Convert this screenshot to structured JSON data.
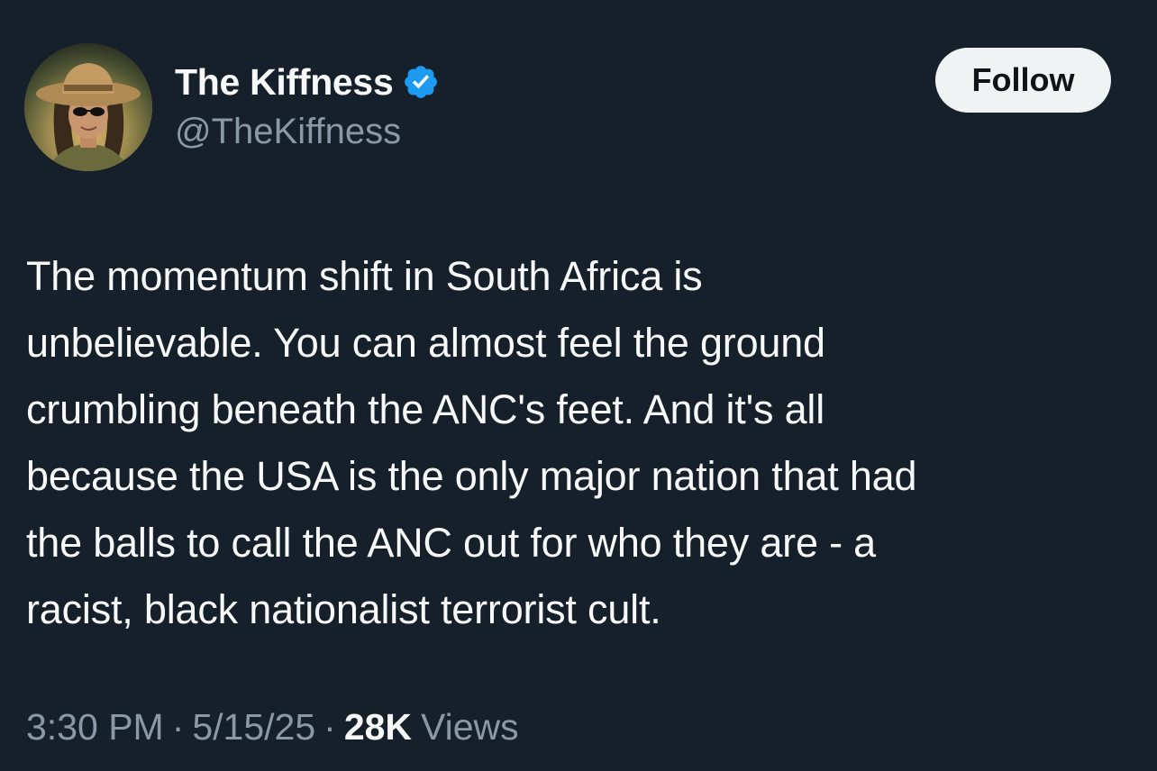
{
  "user": {
    "display_name": "The Kiffness",
    "handle": "@TheKiffness",
    "verified": true,
    "avatar_icon": "profile-photo"
  },
  "follow_button": {
    "label": "Follow"
  },
  "tweet": {
    "lines": [
      "The momentum shift in South Africa is",
      "unbelievable. You can almost feel the ground",
      "crumbling beneath the ANC's feet. And it's all",
      "because the USA is the only major nation that had",
      "the balls to call the ANC out for who they are - a",
      "racist, black nationalist terrorist cult."
    ]
  },
  "meta": {
    "time": "3:30 PM",
    "separator": "·",
    "date": "5/15/25",
    "views_count": "28K",
    "views_label": "Views"
  },
  "colors": {
    "background": "#15202b",
    "text_primary": "#f7f9f9",
    "text_secondary": "#8b98a5",
    "verified_badge": "#1d9bf0",
    "follow_button_bg": "#eff3f4"
  }
}
